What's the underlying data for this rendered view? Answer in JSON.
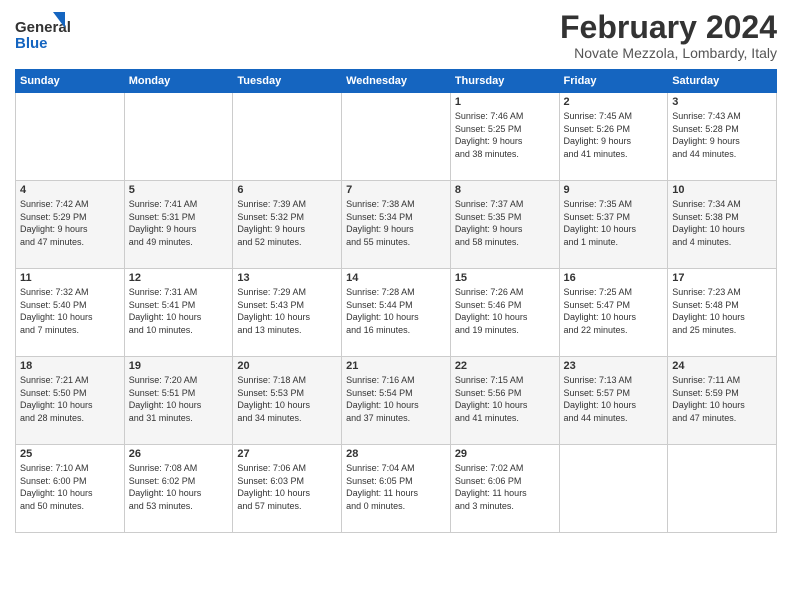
{
  "logo": {
    "line1": "General",
    "line2": "Blue"
  },
  "title": {
    "month_year": "February 2024",
    "location": "Novate Mezzola, Lombardy, Italy"
  },
  "days_of_week": [
    "Sunday",
    "Monday",
    "Tuesday",
    "Wednesday",
    "Thursday",
    "Friday",
    "Saturday"
  ],
  "weeks": [
    [
      {
        "day": "",
        "info": ""
      },
      {
        "day": "",
        "info": ""
      },
      {
        "day": "",
        "info": ""
      },
      {
        "day": "",
        "info": ""
      },
      {
        "day": "1",
        "info": "Sunrise: 7:46 AM\nSunset: 5:25 PM\nDaylight: 9 hours\nand 38 minutes."
      },
      {
        "day": "2",
        "info": "Sunrise: 7:45 AM\nSunset: 5:26 PM\nDaylight: 9 hours\nand 41 minutes."
      },
      {
        "day": "3",
        "info": "Sunrise: 7:43 AM\nSunset: 5:28 PM\nDaylight: 9 hours\nand 44 minutes."
      }
    ],
    [
      {
        "day": "4",
        "info": "Sunrise: 7:42 AM\nSunset: 5:29 PM\nDaylight: 9 hours\nand 47 minutes."
      },
      {
        "day": "5",
        "info": "Sunrise: 7:41 AM\nSunset: 5:31 PM\nDaylight: 9 hours\nand 49 minutes."
      },
      {
        "day": "6",
        "info": "Sunrise: 7:39 AM\nSunset: 5:32 PM\nDaylight: 9 hours\nand 52 minutes."
      },
      {
        "day": "7",
        "info": "Sunrise: 7:38 AM\nSunset: 5:34 PM\nDaylight: 9 hours\nand 55 minutes."
      },
      {
        "day": "8",
        "info": "Sunrise: 7:37 AM\nSunset: 5:35 PM\nDaylight: 9 hours\nand 58 minutes."
      },
      {
        "day": "9",
        "info": "Sunrise: 7:35 AM\nSunset: 5:37 PM\nDaylight: 10 hours\nand 1 minute."
      },
      {
        "day": "10",
        "info": "Sunrise: 7:34 AM\nSunset: 5:38 PM\nDaylight: 10 hours\nand 4 minutes."
      }
    ],
    [
      {
        "day": "11",
        "info": "Sunrise: 7:32 AM\nSunset: 5:40 PM\nDaylight: 10 hours\nand 7 minutes."
      },
      {
        "day": "12",
        "info": "Sunrise: 7:31 AM\nSunset: 5:41 PM\nDaylight: 10 hours\nand 10 minutes."
      },
      {
        "day": "13",
        "info": "Sunrise: 7:29 AM\nSunset: 5:43 PM\nDaylight: 10 hours\nand 13 minutes."
      },
      {
        "day": "14",
        "info": "Sunrise: 7:28 AM\nSunset: 5:44 PM\nDaylight: 10 hours\nand 16 minutes."
      },
      {
        "day": "15",
        "info": "Sunrise: 7:26 AM\nSunset: 5:46 PM\nDaylight: 10 hours\nand 19 minutes."
      },
      {
        "day": "16",
        "info": "Sunrise: 7:25 AM\nSunset: 5:47 PM\nDaylight: 10 hours\nand 22 minutes."
      },
      {
        "day": "17",
        "info": "Sunrise: 7:23 AM\nSunset: 5:48 PM\nDaylight: 10 hours\nand 25 minutes."
      }
    ],
    [
      {
        "day": "18",
        "info": "Sunrise: 7:21 AM\nSunset: 5:50 PM\nDaylight: 10 hours\nand 28 minutes."
      },
      {
        "day": "19",
        "info": "Sunrise: 7:20 AM\nSunset: 5:51 PM\nDaylight: 10 hours\nand 31 minutes."
      },
      {
        "day": "20",
        "info": "Sunrise: 7:18 AM\nSunset: 5:53 PM\nDaylight: 10 hours\nand 34 minutes."
      },
      {
        "day": "21",
        "info": "Sunrise: 7:16 AM\nSunset: 5:54 PM\nDaylight: 10 hours\nand 37 minutes."
      },
      {
        "day": "22",
        "info": "Sunrise: 7:15 AM\nSunset: 5:56 PM\nDaylight: 10 hours\nand 41 minutes."
      },
      {
        "day": "23",
        "info": "Sunrise: 7:13 AM\nSunset: 5:57 PM\nDaylight: 10 hours\nand 44 minutes."
      },
      {
        "day": "24",
        "info": "Sunrise: 7:11 AM\nSunset: 5:59 PM\nDaylight: 10 hours\nand 47 minutes."
      }
    ],
    [
      {
        "day": "25",
        "info": "Sunrise: 7:10 AM\nSunset: 6:00 PM\nDaylight: 10 hours\nand 50 minutes."
      },
      {
        "day": "26",
        "info": "Sunrise: 7:08 AM\nSunset: 6:02 PM\nDaylight: 10 hours\nand 53 minutes."
      },
      {
        "day": "27",
        "info": "Sunrise: 7:06 AM\nSunset: 6:03 PM\nDaylight: 10 hours\nand 57 minutes."
      },
      {
        "day": "28",
        "info": "Sunrise: 7:04 AM\nSunset: 6:05 PM\nDaylight: 11 hours\nand 0 minutes."
      },
      {
        "day": "29",
        "info": "Sunrise: 7:02 AM\nSunset: 6:06 PM\nDaylight: 11 hours\nand 3 minutes."
      },
      {
        "day": "",
        "info": ""
      },
      {
        "day": "",
        "info": ""
      }
    ]
  ]
}
